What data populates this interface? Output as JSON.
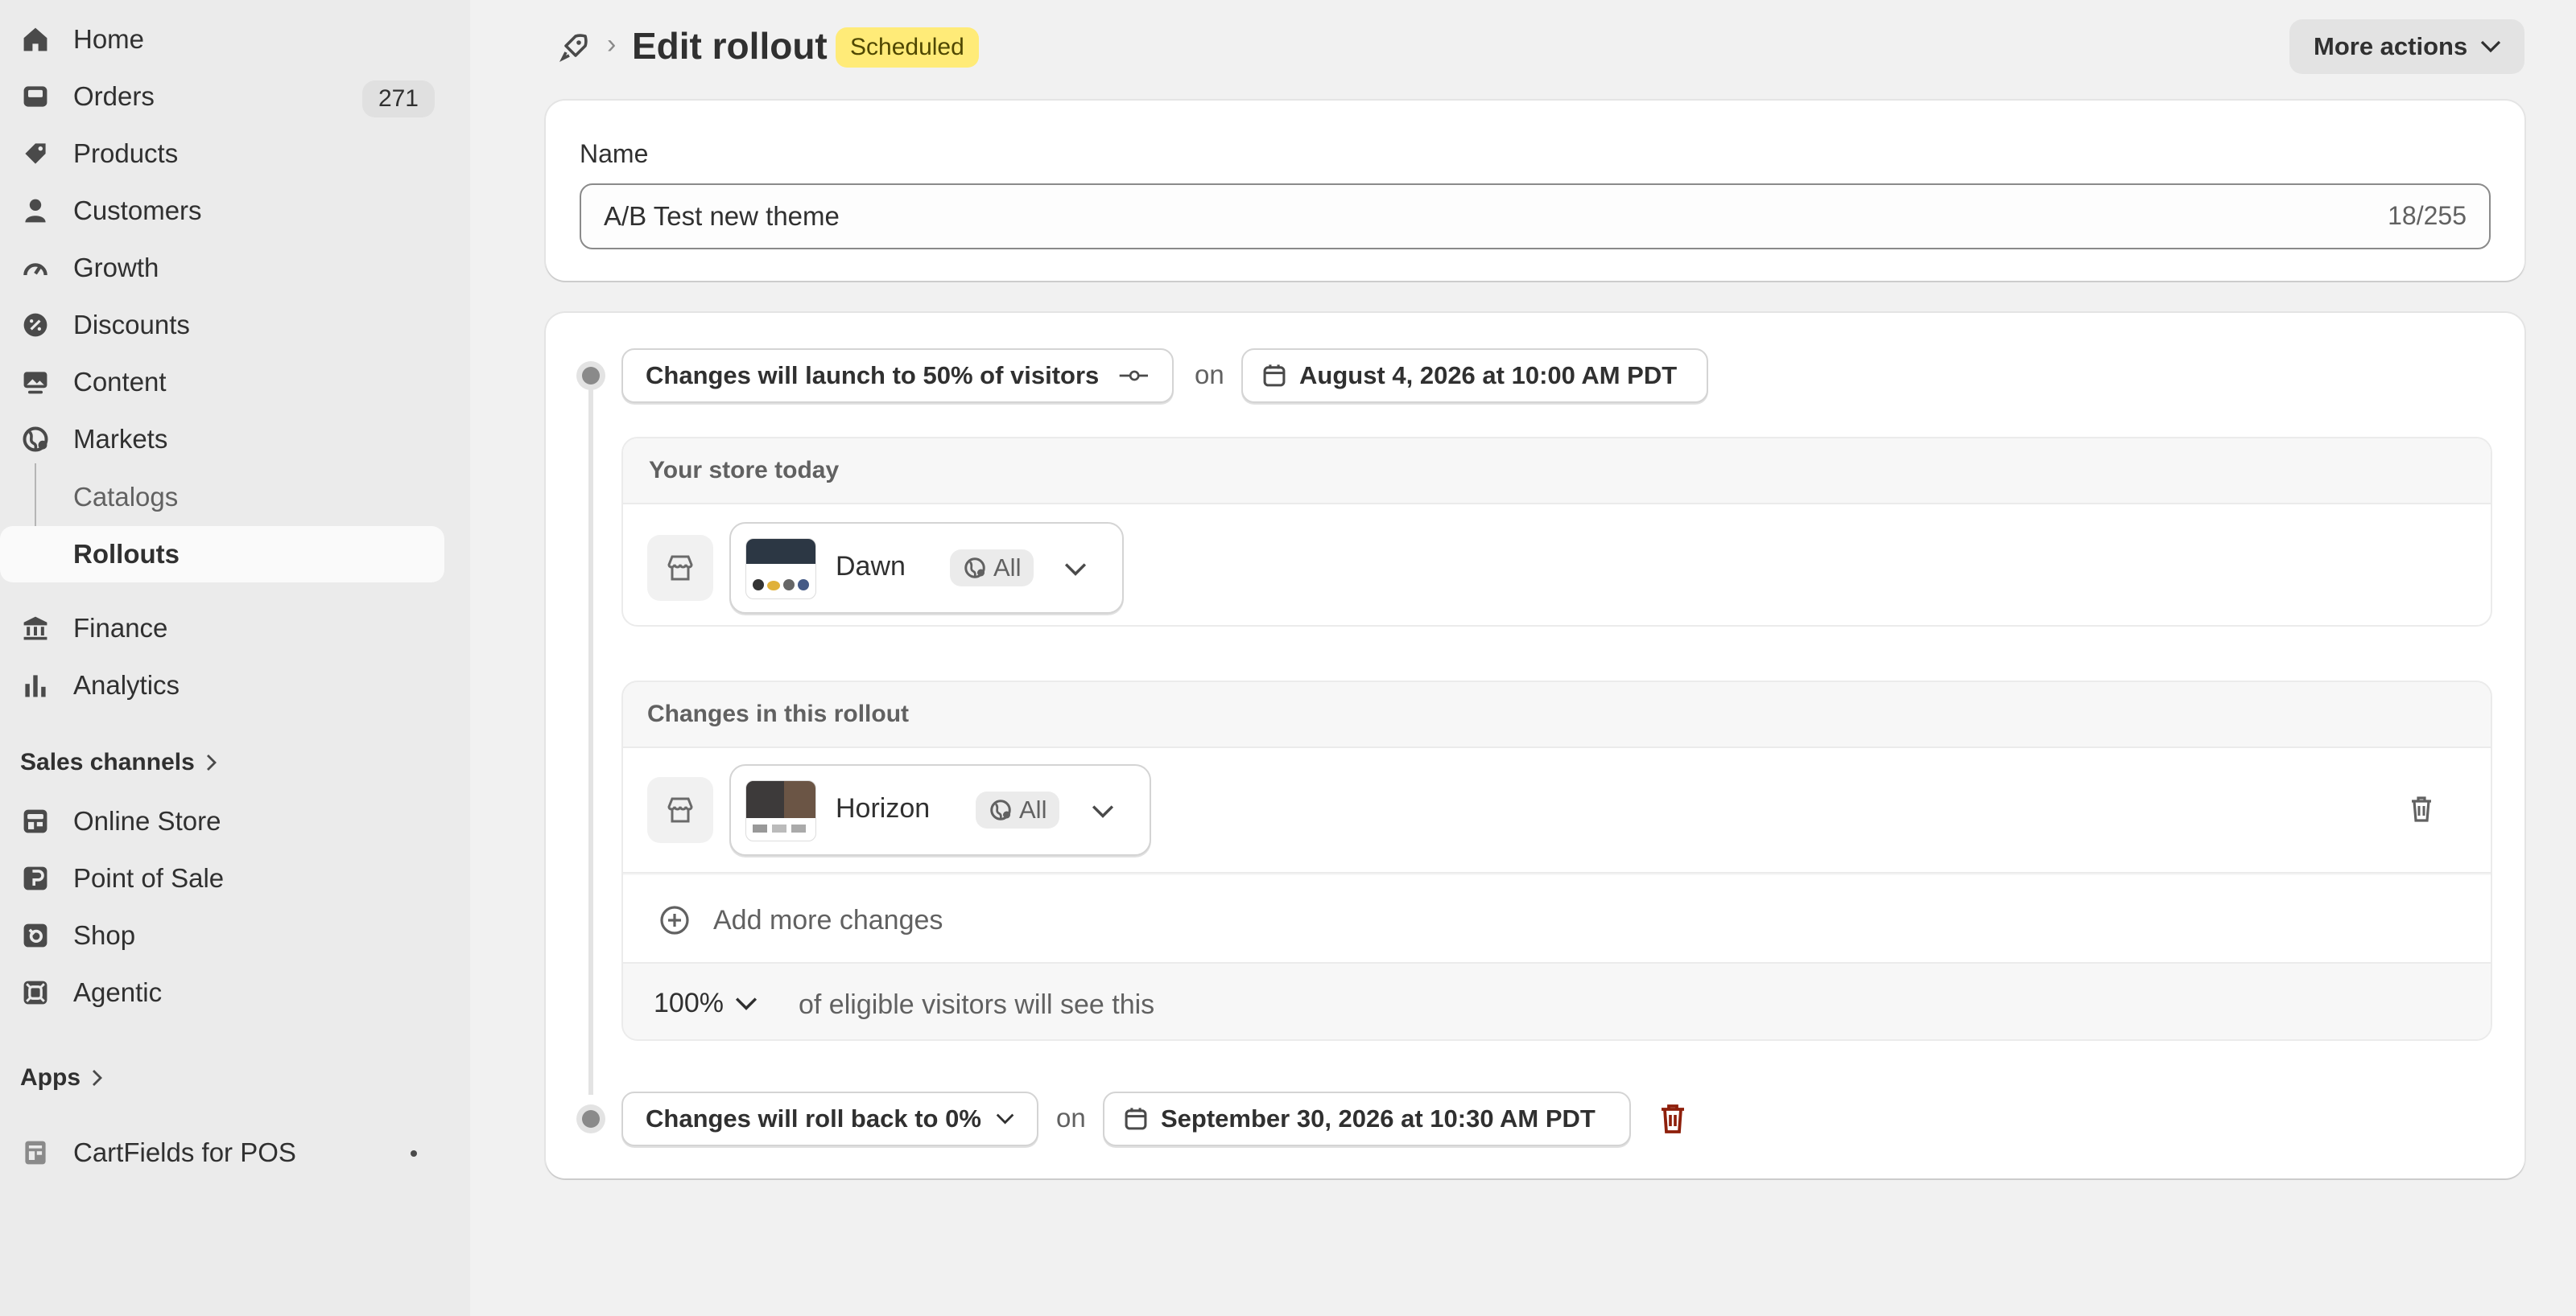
{
  "sidebar": {
    "items": [
      {
        "label": "Home",
        "icon": "home-icon"
      },
      {
        "label": "Orders",
        "icon": "inbox-icon",
        "count": "271"
      },
      {
        "label": "Products",
        "icon": "tag-icon"
      },
      {
        "label": "Customers",
        "icon": "person-icon"
      },
      {
        "label": "Growth",
        "icon": "gauge-icon"
      },
      {
        "label": "Discounts",
        "icon": "discount-icon"
      },
      {
        "label": "Content",
        "icon": "image-icon"
      },
      {
        "label": "Markets",
        "icon": "globe-icon"
      }
    ],
    "sub_items": [
      {
        "label": "Catalogs"
      },
      {
        "label": "Rollouts"
      }
    ],
    "items2": [
      {
        "label": "Finance",
        "icon": "bank-icon"
      },
      {
        "label": "Analytics",
        "icon": "bar-chart-icon"
      }
    ],
    "sales_channels_label": "Sales channels",
    "channels": [
      {
        "label": "Online Store",
        "icon": "store-icon"
      },
      {
        "label": "Point of Sale",
        "icon": "pos-icon"
      },
      {
        "label": "Shop",
        "icon": "shop-icon"
      },
      {
        "label": "Agentic",
        "icon": "agentic-icon"
      }
    ],
    "apps_label": "Apps",
    "apps": [
      {
        "label": "CartFields for POS",
        "icon": "app-icon"
      }
    ]
  },
  "header": {
    "title": "Edit rollout",
    "status_badge": "Scheduled",
    "more_actions": "More actions"
  },
  "name_card": {
    "label": "Name",
    "value": "A/B Test new theme",
    "char_count": "18/255"
  },
  "rollout": {
    "launch_label": "Changes will launch to 50% of visitors",
    "on_1": "on",
    "launch_date": "August 4, 2026 at 10:00 AM PDT",
    "store_today_title": "Your store today",
    "current_theme": {
      "name": "Dawn",
      "region": "All"
    },
    "changes_title": "Changes in this rollout",
    "new_theme": {
      "name": "Horizon",
      "region": "All"
    },
    "add_more": "Add more changes",
    "percent": "100%",
    "eligible_text": "of eligible visitors will see this",
    "rollback_label": "Changes will roll back to 0%",
    "on_2": "on",
    "rollback_date": "September 30, 2026 at 10:30 AM PDT"
  },
  "colors": {
    "badge_bg": "#ffeb78",
    "danger": "#8e1f0b",
    "timeline": "#e3e3e3"
  }
}
